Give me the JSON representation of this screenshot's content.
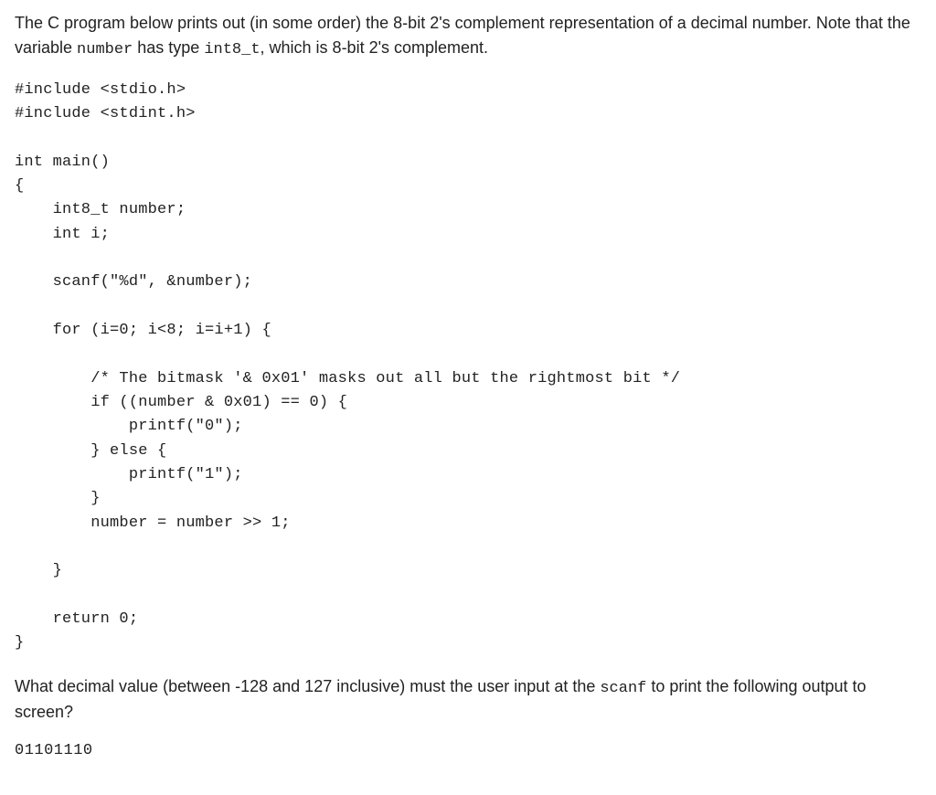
{
  "intro": {
    "part1": "The C program below prints out (in some order) the 8-bit 2's complement representation of a decimal number. Note that the variable ",
    "var_number": "number",
    "part2": " has type ",
    "var_type": "int8_t",
    "part3": ", which is 8-bit 2's complement."
  },
  "code": "#include <stdio.h>\n#include <stdint.h>\n\nint main()\n{\n    int8_t number;\n    int i;\n\n    scanf(\"%d\", &number);\n\n    for (i=0; i<8; i=i+1) {\n\n        /* The bitmask '& 0x01' masks out all but the rightmost bit */\n        if ((number & 0x01) == 0) {\n            printf(\"0\");\n        } else {\n            printf(\"1\");\n        }\n        number = number >> 1;\n\n    }\n\n    return 0;\n}",
  "question": {
    "part1": "What decimal value (between -128 and 127 inclusive) must the user input at the ",
    "scanf": "scanf",
    "part2": " to print the following output to screen?"
  },
  "output": "01101110"
}
